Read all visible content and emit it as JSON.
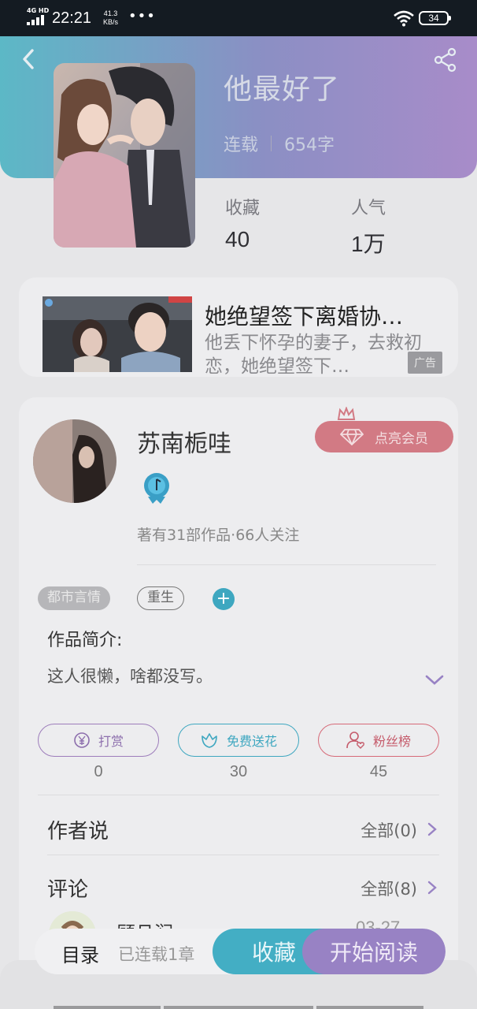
{
  "status_bar": {
    "network": "4G HD",
    "time": "22:21",
    "speed_value": "41.3",
    "speed_unit": "KB/s",
    "more": "•••",
    "battery": "34"
  },
  "header": {
    "back_icon": "chevron-left-icon",
    "share_icon": "share-icon"
  },
  "book": {
    "title": "他最好了",
    "status": "连载",
    "word_count": "654字",
    "stats": [
      {
        "label": "收藏",
        "value": "40"
      },
      {
        "label": "人气",
        "value": "1万"
      }
    ]
  },
  "ad": {
    "title": "她绝望签下离婚协…",
    "description": "他丢下怀孕的妻子，去救初恋，她绝望签下…",
    "tag": "广告"
  },
  "author": {
    "name": "苏南栀哇",
    "vip_button": "点亮会员",
    "stats": "著有31部作品·66人关注"
  },
  "tags": [
    "都市言情",
    "重生"
  ],
  "add_tag": "+",
  "intro": {
    "title": "作品简介:",
    "text": "这人很懒，啥都没写。"
  },
  "actions": [
    {
      "label": "打赏",
      "count": "0"
    },
    {
      "label": "免费送花",
      "count": "30"
    },
    {
      "label": "粉丝榜",
      "count": "45"
    }
  ],
  "author_says": {
    "title": "作者说",
    "link": "全部(0)"
  },
  "comments": {
    "title": "评论",
    "link": "全部(8)",
    "first_name": "顾且润",
    "first_date": "03-27"
  },
  "bottom_bar": {
    "catalog": "目录",
    "status": "已连载1章",
    "collect": "收藏",
    "read": "开始阅读"
  },
  "colors": {
    "accent_teal": "#3ea7c0",
    "accent_purple": "#9882c4",
    "vip_pink": "#d27a84"
  }
}
